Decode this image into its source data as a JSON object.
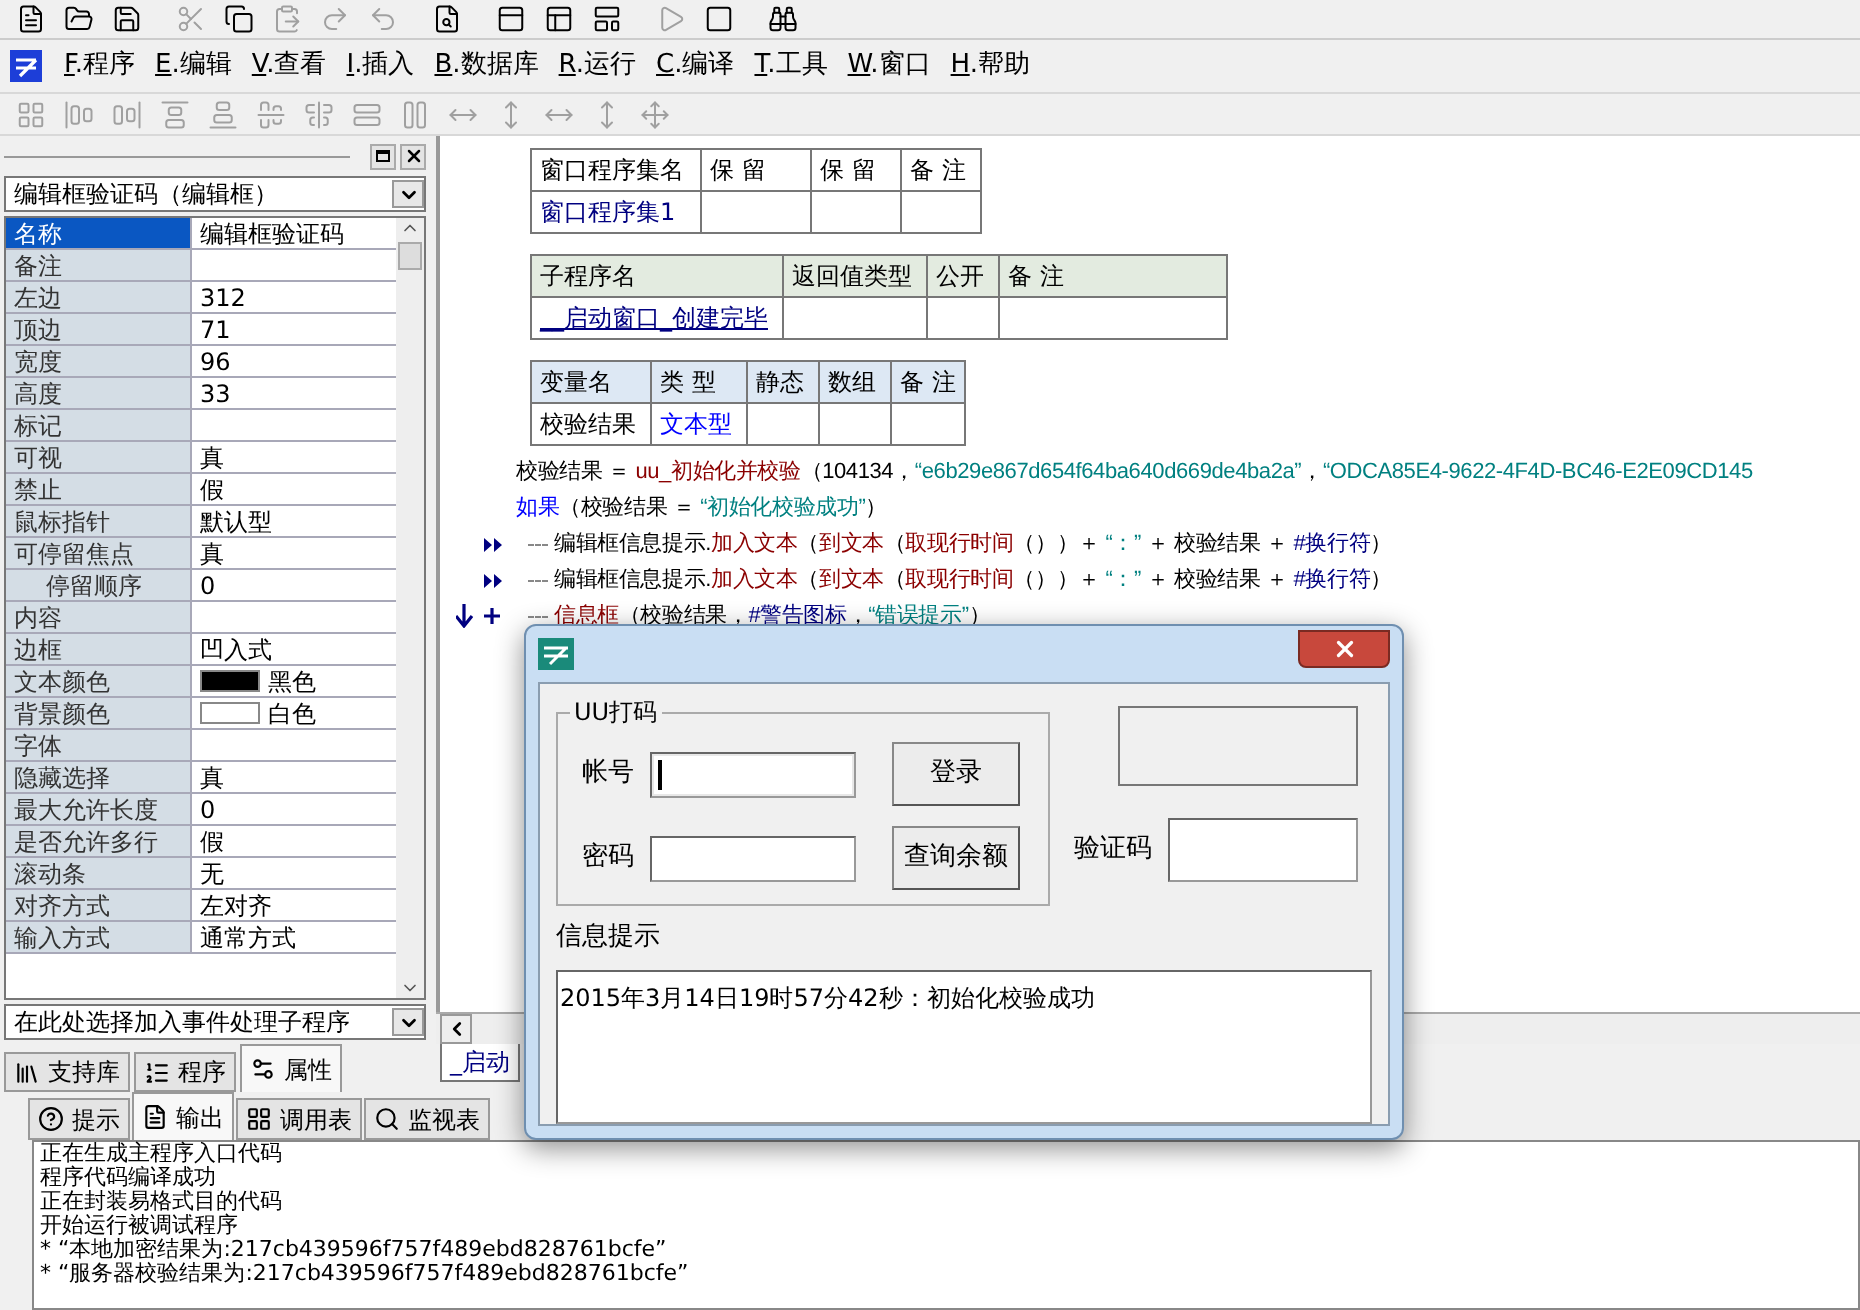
{
  "menu": [
    {
      "mnemonic": "F",
      "label": ".程序"
    },
    {
      "mnemonic": "E",
      "label": ".编辑"
    },
    {
      "mnemonic": "V",
      "label": ".查看"
    },
    {
      "mnemonic": "I",
      "label": ".插入"
    },
    {
      "mnemonic": "B",
      "label": ".数据库"
    },
    {
      "mnemonic": "R",
      "label": ".运行"
    },
    {
      "mnemonic": "C",
      "label": ".编译"
    },
    {
      "mnemonic": "T",
      "label": ".工具"
    },
    {
      "mnemonic": "W",
      "label": ".窗口"
    },
    {
      "mnemonic": "H",
      "label": ".帮助"
    }
  ],
  "property_panel": {
    "object_select": "编辑框验证码（编辑框）",
    "rows": [
      {
        "name": "名称",
        "value": "编辑框验证码",
        "selected": true
      },
      {
        "name": "备注",
        "selected": false
      },
      {
        "name": "左边",
        "value": "312",
        "selected": false
      },
      {
        "name": "顶边",
        "value": "71",
        "selected": false
      },
      {
        "name": "宽度",
        "value": "96",
        "selected": false
      },
      {
        "name": "高度",
        "value": "33",
        "selected": false
      },
      {
        "name": "标记",
        "selected": false
      },
      {
        "name": "可视",
        "value": "真",
        "selected": false
      },
      {
        "name": "禁止",
        "value": "假",
        "selected": false
      },
      {
        "name": "鼠标指针",
        "value": "默认型",
        "selected": false
      },
      {
        "name": "可停留焦点",
        "value": "真",
        "selected": false,
        "children": [
          {
            "name": "停留顺序",
            "value": "0",
            "selected": false
          }
        ]
      },
      {
        "name": "内容",
        "selected": false
      },
      {
        "name": "边框",
        "value": "凹入式",
        "selected": false
      },
      {
        "name": "文本颜色",
        "value": "黑色",
        "selected": false,
        "color": "#000000"
      },
      {
        "name": "背景颜色",
        "value": "白色",
        "selected": false,
        "color": "#ffffff"
      },
      {
        "name": "字体",
        "selected": false
      },
      {
        "name": "隐藏选择",
        "value": "真",
        "selected": false
      },
      {
        "name": "最大允许长度",
        "value": "0",
        "selected": false
      },
      {
        "name": "是否允许多行",
        "value": "假",
        "selected": false
      },
      {
        "name": "滚动条",
        "value": "无",
        "selected": false
      },
      {
        "name": "对齐方式",
        "value": "左对齐",
        "selected": false
      },
      {
        "name": "输入方式",
        "value": "通常方式",
        "selected": false
      }
    ],
    "event_select": "在此处选择加入事件处理子程序",
    "tabs": [
      {
        "label": "支持库",
        "kind": "library",
        "selected": false
      },
      {
        "label": "程序",
        "kind": "program",
        "selected": false
      },
      {
        "label": "属性",
        "kind": "property",
        "selected": true
      }
    ]
  },
  "editor": {
    "tables": [
      {
        "kind": "assembly",
        "columns": [
          "窗口程序集名",
          "保 留",
          "保 留",
          "备 注"
        ],
        "rows": [
          [
            "窗口程序集1",
            "",
            "",
            ""
          ]
        ]
      },
      {
        "kind": "subroutine",
        "columns": [
          "子程序名",
          "返回值类型",
          "公开",
          "备 注"
        ],
        "rows": [
          [
            "__启动窗口_创建完毕",
            "",
            "",
            ""
          ]
        ]
      },
      {
        "kind": "variables",
        "columns": [
          "变量名",
          "类 型",
          "静态",
          "数组",
          "备 注"
        ],
        "rows": [
          [
            "校验结果",
            "文本型",
            "",
            "",
            ""
          ]
        ]
      }
    ],
    "lines": [
      {
        "tokens": [
          {
            "t": "校验结果 ＝ ",
            "kind": "plain"
          },
          {
            "t": "uu_初始化并校验",
            "kind": "func"
          },
          {
            "t": "（104134，",
            "kind": "plain"
          },
          {
            "t": "“e6b29e867d654f64ba640d669de4ba2a”",
            "kind": "string"
          },
          {
            "t": "，",
            "kind": "plain"
          },
          {
            "t": "“ODCA85E4-9622-4F4D-BC46-E2E09CD145",
            "kind": "string"
          }
        ]
      },
      {
        "tokens": [
          {
            "t": "如果",
            "kind": "keyword"
          },
          {
            "t": "（校验结果 ＝ ",
            "kind": "plain"
          },
          {
            "t": "“初始化校验成功”",
            "kind": "string"
          },
          {
            "t": "）",
            "kind": "plain"
          }
        ],
        "children": [
          {
            "kind": "arrows",
            "tokens": [
              {
                "t": "编辑框信息提示.",
                "kind": "plain"
              },
              {
                "t": "加入文本",
                "kind": "func"
              },
              {
                "t": "（",
                "kind": "plain"
              },
              {
                "t": "到文本",
                "kind": "func"
              },
              {
                "t": "（",
                "kind": "plain"
              },
              {
                "t": "取现行时间",
                "kind": "func"
              },
              {
                "t": "（））＋ ",
                "kind": "plain"
              },
              {
                "t": "“：”",
                "kind": "string"
              },
              {
                "t": " ＋ 校验结果 ＋ ",
                "kind": "plain"
              },
              {
                "t": "#换行符",
                "kind": "const"
              },
              {
                "t": "）",
                "kind": "plain"
              }
            ]
          },
          {
            "kind": "arrows",
            "tokens": [
              {
                "t": "编辑框信息提示.",
                "kind": "plain"
              },
              {
                "t": "加入文本",
                "kind": "func"
              },
              {
                "t": "（",
                "kind": "plain"
              },
              {
                "t": "到文本",
                "kind": "func"
              },
              {
                "t": "（",
                "kind": "plain"
              },
              {
                "t": "取现行时间",
                "kind": "func"
              },
              {
                "t": "（））＋ ",
                "kind": "plain"
              },
              {
                "t": "“：”",
                "kind": "string"
              },
              {
                "t": " ＋ 校验结果 ＋ ",
                "kind": "plain"
              },
              {
                "t": "#换行符",
                "kind": "const"
              },
              {
                "t": "）",
                "kind": "plain"
              }
            ]
          },
          {
            "kind": "cursor",
            "tokens": [
              {
                "t": "信息框",
                "kind": "func"
              },
              {
                "t": "（校验结果，",
                "kind": "plain"
              },
              {
                "t": "#警告图标",
                "kind": "const"
              },
              {
                "t": "，",
                "kind": "plain"
              },
              {
                "t": "“错误提示”",
                "kind": "string"
              },
              {
                "t": "）",
                "kind": "plain"
              }
            ]
          }
        ]
      }
    ],
    "tab": "_启动"
  },
  "output": {
    "tabs": [
      {
        "label": "提示",
        "kind": "hint",
        "selected": false
      },
      {
        "label": "输出",
        "kind": "output",
        "selected": true
      },
      {
        "label": "调用表",
        "kind": "calls",
        "selected": false
      },
      {
        "label": "监视表",
        "kind": "watch",
        "selected": false
      }
    ],
    "lines": [
      "正在生成主程序入口代码",
      "程序代码编译成功",
      "正在封装易格式目的代码",
      "开始运行被调试程序",
      "*  “本地加密结果为:217cb439596f757f489ebd828761bcfe”",
      "*  “服务器校验结果为:217cb439596f757f489ebd828761bcfe”"
    ]
  },
  "dialog": {
    "group_title": "UU打码",
    "fields": [
      {
        "label": "帐号",
        "focused": true
      },
      {
        "label": "密码",
        "focused": false
      }
    ],
    "buttons": [
      "登录",
      "查询余额"
    ],
    "captcha_label": "验证码",
    "info_label": "信息提示",
    "info_text": "2015年3月14日19时57分42秒：初始化校验成功"
  }
}
